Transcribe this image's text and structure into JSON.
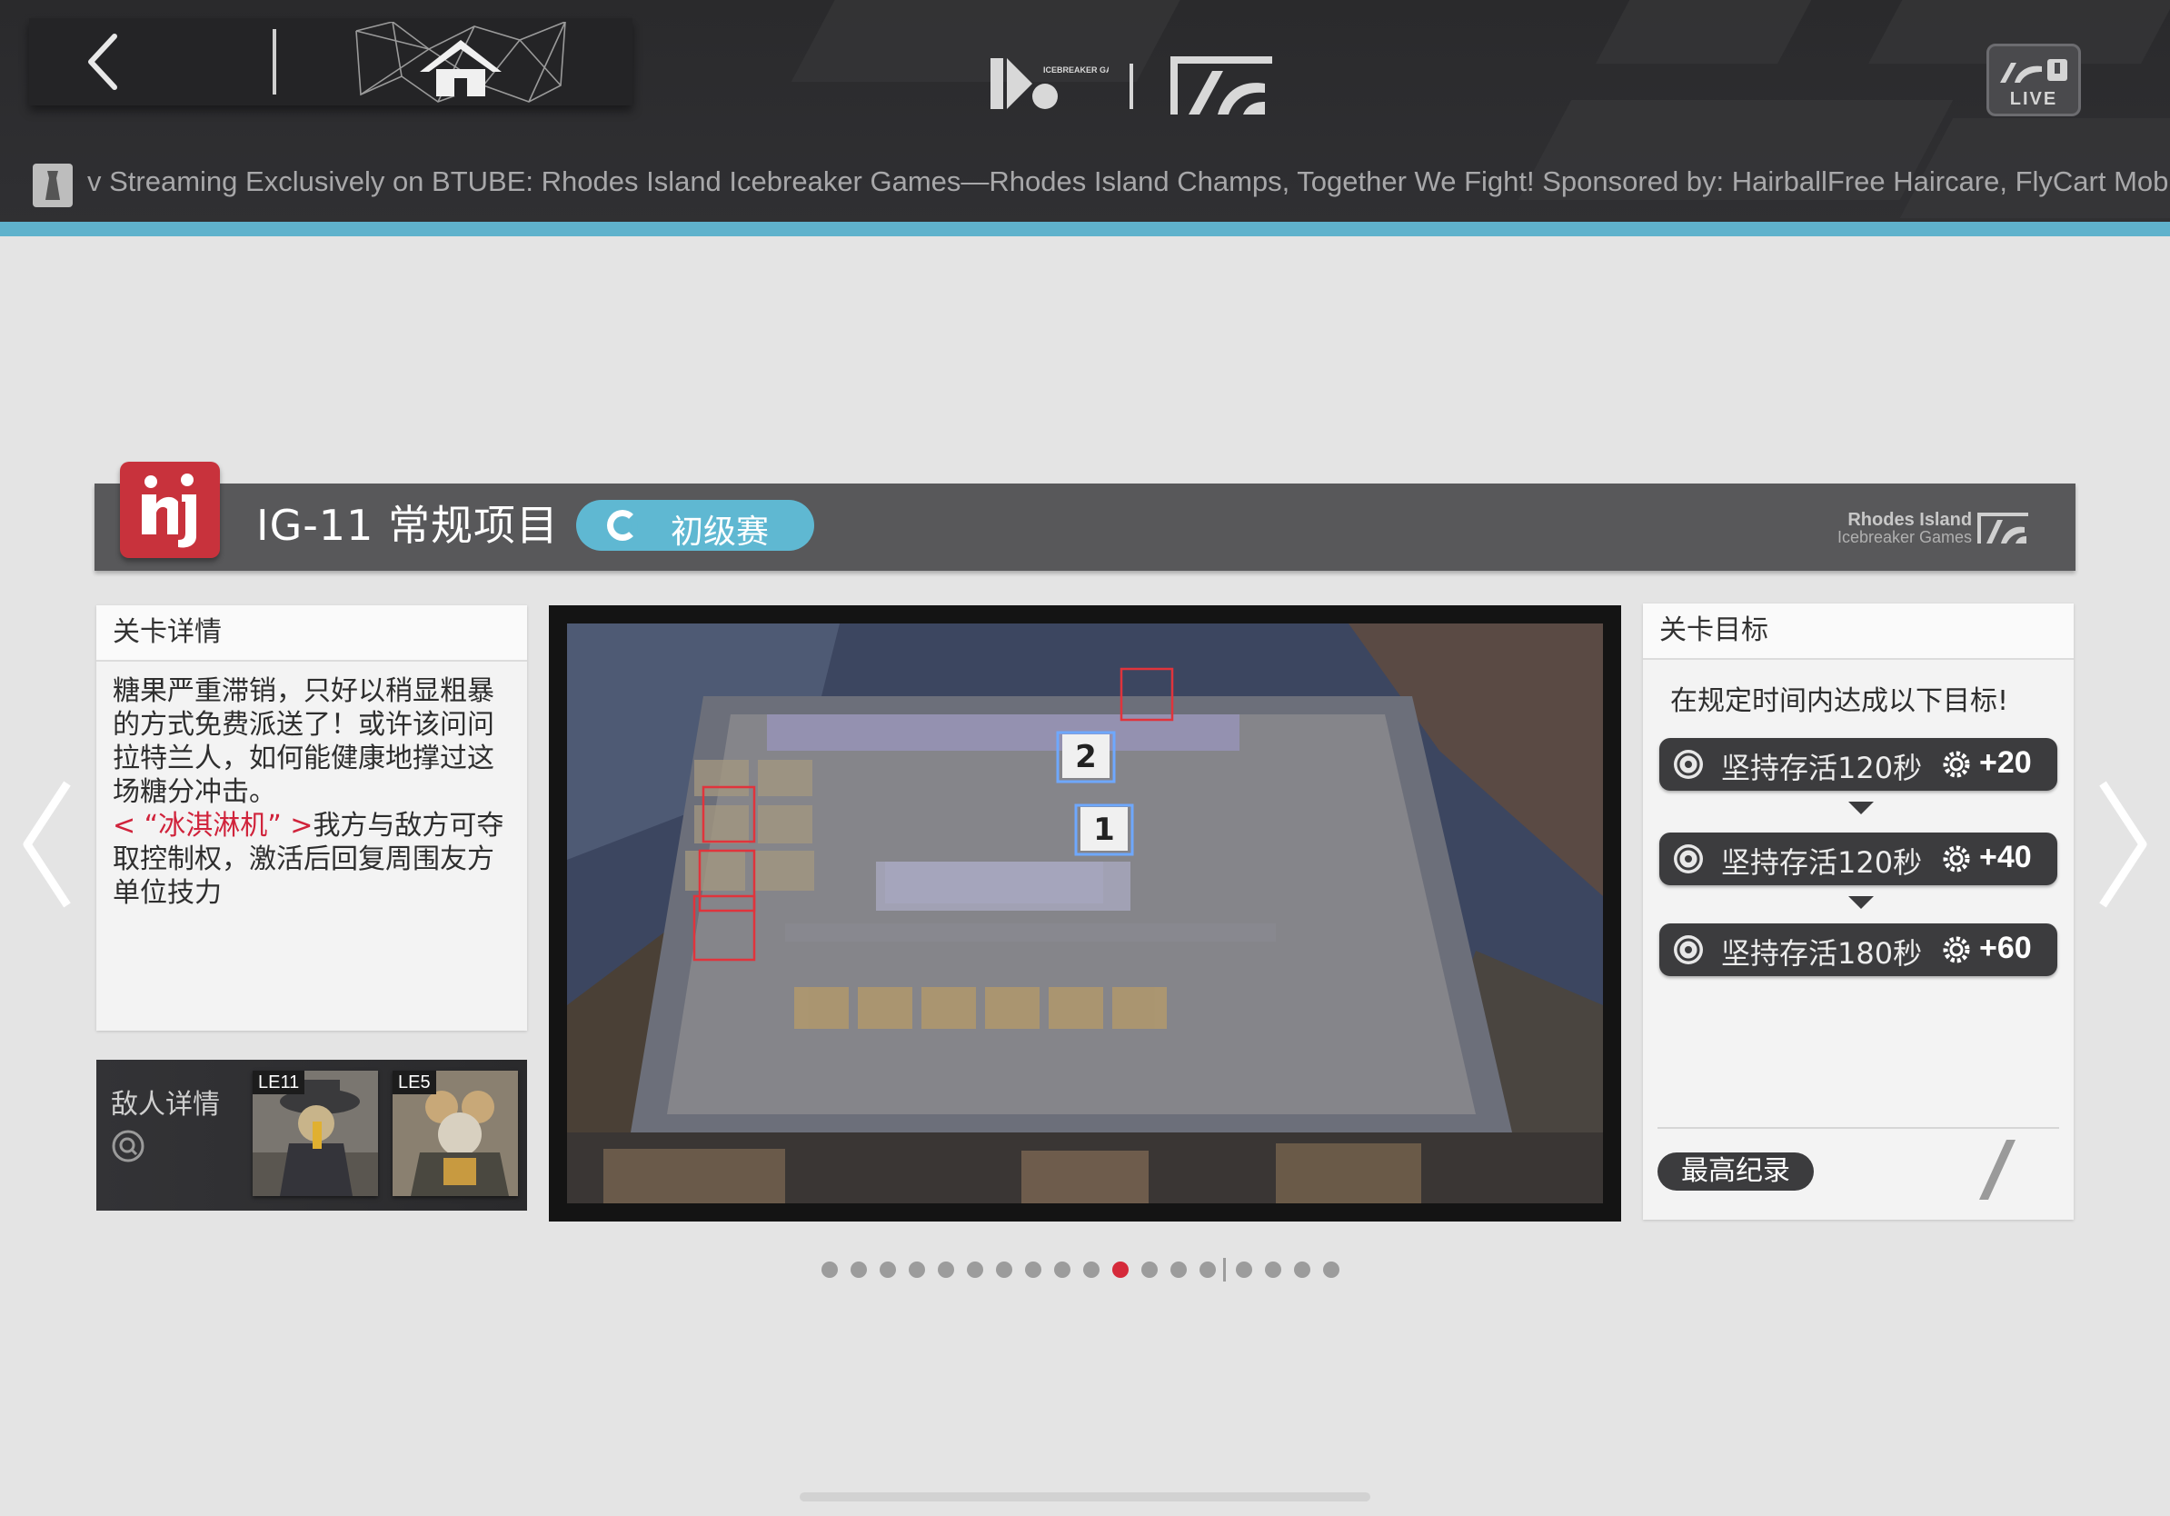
{
  "topbar": {
    "ticker": "v Streaming Exclusively on BTUBE:  Rhodes Island Icebreaker Games—Rhodes Island Champs, Together We Fight! Sponsored by: HairballFree Haircare, FlyCart Mobile",
    "live_label": "LIVE",
    "logo_small_text": "ICEBREAKER GAMES"
  },
  "stage": {
    "badge_text": "IG",
    "code_title": "IG-11 常规项目",
    "difficulty": "初级赛",
    "brand_line1": "Rhodes Island",
    "brand_line2": "Icebreaker Games"
  },
  "detail": {
    "header": "关卡详情",
    "text_main": "糖果严重滞销，只好以稍显粗暴的方式免费派送了！或许该问问拉特兰人，如何能健康地撑过这场糖分冲击。",
    "text_highlight": "< “冰淇淋机” >",
    "text_tail": "我方与敌方可夺取控制权，激活后回复周围友方单位技力"
  },
  "enemies": {
    "header": "敌人详情",
    "list": [
      {
        "level": "LE11"
      },
      {
        "level": "LE5"
      }
    ]
  },
  "map": {
    "markers": [
      "2",
      "1"
    ]
  },
  "objectives": {
    "header": "关卡目标",
    "intro": "在规定时间内达成以下目标!",
    "items": [
      {
        "text": "坚持存活120秒",
        "reward": "+20"
      },
      {
        "text": "坚持存活120秒",
        "reward": "+40"
      },
      {
        "text": "坚持存活180秒",
        "reward": "+60"
      }
    ],
    "best_label": "最高纪录"
  },
  "pager": {
    "count_before_sep": 14,
    "count_after_sep": 4,
    "active_index": 10
  },
  "colors": {
    "accent_cyan": "#5fb8d2",
    "badge_red": "#c8323c",
    "active_dot": "#d52a3a",
    "highlight_red": "#d0233b"
  }
}
